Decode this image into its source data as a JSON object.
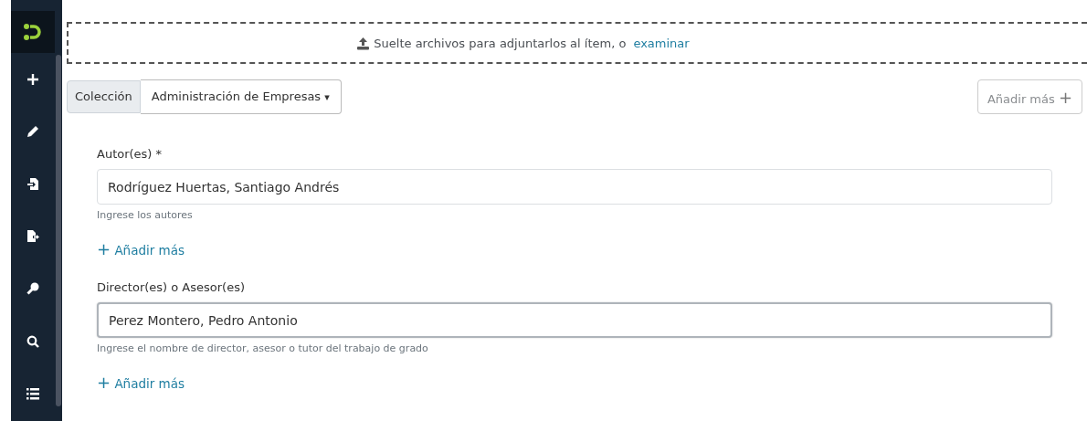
{
  "sidebar": {
    "items": [
      {
        "kind": "plus"
      },
      {
        "kind": "pencil"
      },
      {
        "kind": "import"
      },
      {
        "kind": "export"
      },
      {
        "kind": "key"
      },
      {
        "kind": "search"
      },
      {
        "kind": "list"
      }
    ]
  },
  "dropzone": {
    "text": "Suelte archivos para adjuntarlos al ítem, o",
    "link": "examinar"
  },
  "collection": {
    "label": "Colección",
    "value": "Administración de Empresas",
    "caret": "▾"
  },
  "add_more_button": {
    "label": "Añadir más",
    "icon": "+"
  },
  "fields": [
    {
      "label": "Autor(es) *",
      "value": "Rodríguez Huertas, Santiago Andrés",
      "focused": false,
      "hint": "Ingrese los autores",
      "add": "Añadir más"
    },
    {
      "label": "Director(es) o Asesor(es)",
      "value": "Perez Montero, Pedro Antonio",
      "focused": true,
      "hint": "Ingrese el nombre de director, asesor o tutor del trabajo de grado",
      "add": "Añadir más"
    }
  ]
}
